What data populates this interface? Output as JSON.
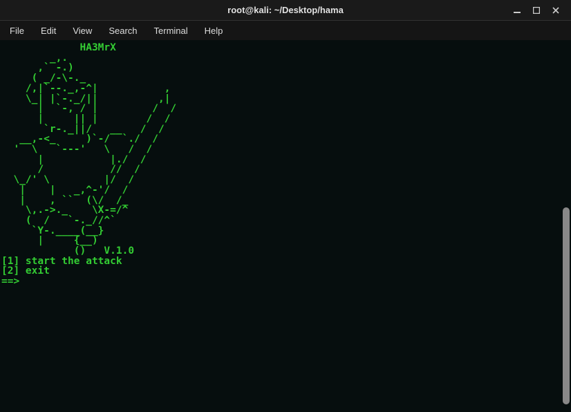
{
  "titlebar": {
    "title": "root@kali: ~/Desktop/hama"
  },
  "menubar": {
    "items": [
      {
        "label": "File"
      },
      {
        "label": "Edit"
      },
      {
        "label": "View"
      },
      {
        "label": "Search"
      },
      {
        "label": "Terminal"
      },
      {
        "label": "Help"
      }
    ]
  },
  "terminal": {
    "banner_name": "             HA3MrX",
    "ascii_art": "        _,.\n      ,` -.)\n     ( _/-\\-._\n    /,|`--._,-^|           ,\n    \\_| |`-._/||          ,|\n      |  `-, / |         /  /\n      |     || |        /  /\n       `r-._||/   __   /  /\n   __,-<_     )`-/  `./  /\n  '  \\   `---'   \\   /  /\n      |           |./  /\n      /           //  /\n  \\_/' \\         |/  /\n   |    |   _,^-'/  /\n   |    , ``  (\\/  /_\n    \\,.->._    \\X-=/^\n    (  /   `-._//^`\n     `Y-.____(__}\n      |     {__)\n            ()   V.1.0",
    "option1": "[1] start the attack",
    "option2": "[2] exit",
    "prompt": "==>"
  }
}
